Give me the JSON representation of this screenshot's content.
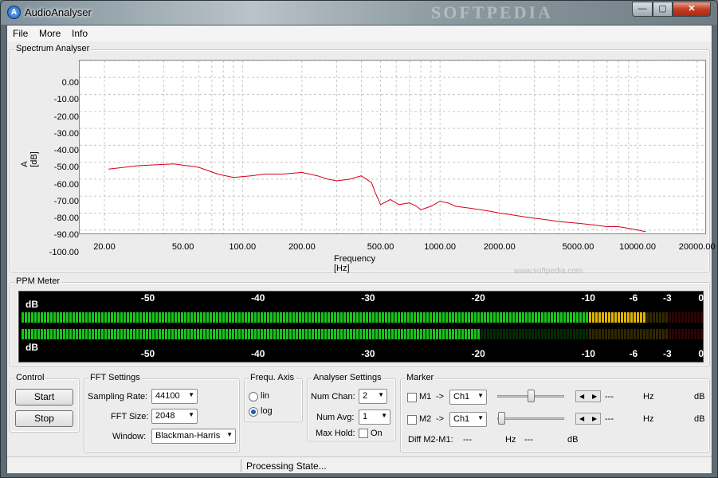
{
  "window": {
    "title": "AudioAnalyser",
    "watermark": "SOFTPEDIA",
    "min_glyph": "—",
    "max_glyph": "▢",
    "close_glyph": "✕"
  },
  "menu": {
    "file": "File",
    "more": "More",
    "info": "Info"
  },
  "spectrum": {
    "group_title": "Spectrum Analyser",
    "watermark": "www.softpedia.com",
    "chart_data": {
      "type": "line",
      "ylabel": "A [dB]",
      "xlabel": "Frequency [Hz]",
      "x_scale": "log",
      "xlim": [
        15,
        22000
      ],
      "ylim": [
        -102,
        0
      ],
      "y_ticks": [
        "0.00",
        "-10.00",
        "-20.00",
        "-30.00",
        "-40.00",
        "-50.00",
        "-60.00",
        "-70.00",
        "-80.00",
        "-90.00",
        "-100.00"
      ],
      "x_ticks": [
        {
          "v": 20,
          "label": "20.00"
        },
        {
          "v": 50,
          "label": "50.00"
        },
        {
          "v": 100,
          "label": "100.00"
        },
        {
          "v": 200,
          "label": "200.00"
        },
        {
          "v": 500,
          "label": "500.00"
        },
        {
          "v": 1000,
          "label": "1000.00"
        },
        {
          "v": 2000,
          "label": "2000.00"
        },
        {
          "v": 5000,
          "label": "5000.00"
        },
        {
          "v": 10000,
          "label": "10000.00"
        },
        {
          "v": 20000,
          "label": "20000.00"
        }
      ],
      "grid": true,
      "series": [
        {
          "color": "#d4001a",
          "x": [
            21,
            30,
            45,
            60,
            75,
            90,
            110,
            130,
            160,
            200,
            240,
            270,
            300,
            350,
            400,
            450,
            470,
            500,
            560,
            620,
            700,
            760,
            800,
            900,
            1000,
            1100,
            1200,
            1400,
            1600,
            1800,
            2000,
            2300,
            2600,
            3000,
            3500,
            4000,
            5000,
            6000,
            7000,
            8000,
            9000,
            10000,
            11000
          ],
          "y": [
            -64,
            -62,
            -61,
            -63,
            -67,
            -69,
            -68,
            -67,
            -67,
            -66,
            -68,
            -70,
            -71,
            -70,
            -68,
            -72,
            -78,
            -85,
            -82,
            -85,
            -84,
            -86,
            -88,
            -86,
            -83,
            -84,
            -86,
            -87,
            -88,
            -89,
            -90,
            -91,
            -92,
            -93,
            -94,
            -95,
            -96,
            -97,
            -98,
            -98,
            -99,
            -100,
            -101
          ]
        }
      ]
    }
  },
  "ppm": {
    "group_title": "PPM Meter",
    "db_label": "dB",
    "scale": [
      {
        "v": -50,
        "label": "-50"
      },
      {
        "v": -40,
        "label": "-40"
      },
      {
        "v": -30,
        "label": "-30"
      },
      {
        "v": -20,
        "label": "-20"
      },
      {
        "v": -10,
        "label": "-10"
      },
      {
        "v": -6,
        "label": "-6"
      },
      {
        "v": -3,
        "label": "-3"
      },
      {
        "v": 0,
        "label": "0"
      }
    ],
    "level_ch1_db": -5,
    "level_ch2_db": -20,
    "colors": {
      "green": "#19c41b",
      "yellow": "#e0b400",
      "red": "#d01010"
    }
  },
  "control": {
    "title": "Control",
    "start": "Start",
    "stop": "Stop"
  },
  "fft": {
    "title": "FFT Settings",
    "sampling_rate_label": "Sampling Rate:",
    "sampling_rate": "44100",
    "fft_size_label": "FFT Size:",
    "fft_size": "2048",
    "window_label": "Window:",
    "window": "Blackman-Harris"
  },
  "frequ_axis": {
    "title": "Frequ. Axis",
    "lin": "lin",
    "log": "log",
    "selected": "log"
  },
  "analyser": {
    "title": "Analyser Settings",
    "num_chan_label": "Num Chan:",
    "num_chan": "2",
    "num_avg_label": "Num Avg:",
    "num_avg": "1",
    "max_hold_label": "Max Hold:",
    "max_hold_check": "On"
  },
  "marker": {
    "title": "Marker",
    "m1_label": "M1",
    "m2_label": "M2",
    "arrow": "->",
    "m1_channel": "Ch1",
    "m2_channel": "Ch1",
    "dashes": "---",
    "hz": "Hz",
    "db": "dB",
    "diff_label": "Diff M2-M1:"
  },
  "status": {
    "text": "Processing State..."
  }
}
